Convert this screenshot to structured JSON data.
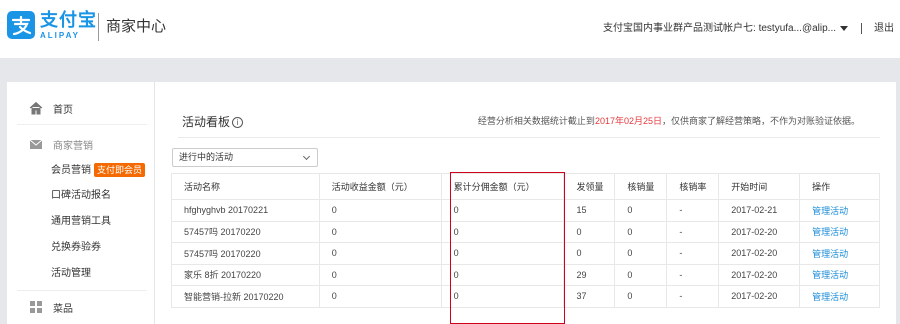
{
  "header": {
    "logo_cn": "支付宝",
    "logo_en": "ALIPAY",
    "logo_sub": "商家中心",
    "account": "支付宝国内事业群产品测试帐户七: testyufa...@alip...",
    "logout": "退出"
  },
  "sidebar": {
    "home": "首页",
    "marketing": "商家营销",
    "items": [
      {
        "label": "会员营销",
        "badge": "支付即会员"
      },
      {
        "label": "口碑活动报名"
      },
      {
        "label": "通用营销工具"
      },
      {
        "label": "兑换券验券"
      },
      {
        "label": "活动管理"
      }
    ],
    "dishes": "菜品"
  },
  "panel": {
    "title": "活动看板",
    "info": "i",
    "notice_pre": "经营分析相关数据统计截止到",
    "notice_date": "2017年02月25日",
    "notice_post": "，仅供商家了解经营策略，不作为对账验证依据。",
    "filter_value": "进行中的活动"
  },
  "table": {
    "headers": [
      "活动名称",
      "活动收益金额（元）",
      "累计分佣金额（元）",
      "发领量",
      "核销量",
      "核销率",
      "开始时间",
      "操作"
    ],
    "rows": [
      [
        "hfghyghvb 20170221",
        "0",
        "0",
        "15",
        "0",
        "-",
        "2017-02-21",
        "管理活动"
      ],
      [
        "57457吗 20170220",
        "0",
        "0",
        "0",
        "0",
        "-",
        "2017-02-20",
        "管理活动"
      ],
      [
        "57457吗 20170220",
        "0",
        "0",
        "0",
        "0",
        "-",
        "2017-02-20",
        "管理活动"
      ],
      [
        "家乐 8折 20170220",
        "0",
        "0",
        "29",
        "0",
        "-",
        "2017-02-20",
        "管理活动"
      ],
      [
        "智能营销-拉新 20170220",
        "0",
        "0",
        "37",
        "0",
        "-",
        "2017-02-20",
        "管理活动"
      ]
    ]
  },
  "colors": {
    "brand": "#1a95e6",
    "accent_badge": "#f56a00",
    "highlight_box": "#d0021b",
    "link": "#1a8cd8"
  }
}
